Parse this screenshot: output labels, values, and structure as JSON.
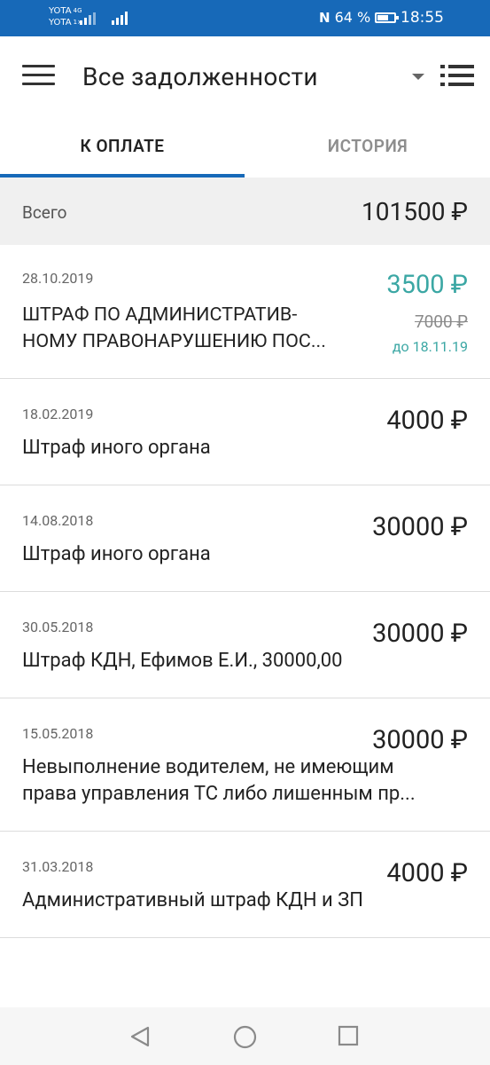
{
  "status_bar": {
    "carrier1": "YOTA",
    "carrier1_tag": "4G",
    "carrier2": "YOTA",
    "carrier2_tag": "1×",
    "nfc": "N",
    "battery_text": "64 %",
    "time": "18:55"
  },
  "app_bar": {
    "title": "Все задолженности"
  },
  "tabs": [
    {
      "label": "К ОПЛАТЕ",
      "active": true
    },
    {
      "label": "ИСТОРИЯ",
      "active": false
    }
  ],
  "total": {
    "label": "Всего",
    "value": "101500 ₽"
  },
  "items": [
    {
      "date": "28.10.2019",
      "desc1": "ШТРАФ ПО АДМИНИСТРАТИВ-",
      "desc2": "НОМУ ПРАВОНАРУШЕНИЮ ПОС...",
      "amount": "3500 ₽",
      "old_amount": "7000 ₽",
      "due": "до 18.11.19"
    },
    {
      "date": "18.02.2019",
      "desc1": "Штраф иного органа",
      "amount": "4000 ₽"
    },
    {
      "date": "14.08.2018",
      "desc1": "Штраф иного органа",
      "amount": "30000 ₽"
    },
    {
      "date": "30.05.2018",
      "desc1": "Штраф КДН, Ефимов Е.И., 30000,00",
      "amount": "30000 ₽"
    },
    {
      "date": "15.05.2018",
      "desc1": "Невыполнение водителем, не имеющим",
      "desc2": "права управления ТС либо лишенным пр...",
      "amount": "30000 ₽"
    },
    {
      "date": "31.03.2018",
      "desc1": "Административный штраф КДН и ЗП",
      "amount": "4000 ₽"
    }
  ],
  "nav_bar": {
    "back": "back-triangle-icon",
    "home": "home-circle-icon",
    "recents": "recents-square-icon"
  },
  "colors": {
    "status_bar": "#1769b8",
    "accent": "#1769b8",
    "discount": "#3ba7a4"
  }
}
